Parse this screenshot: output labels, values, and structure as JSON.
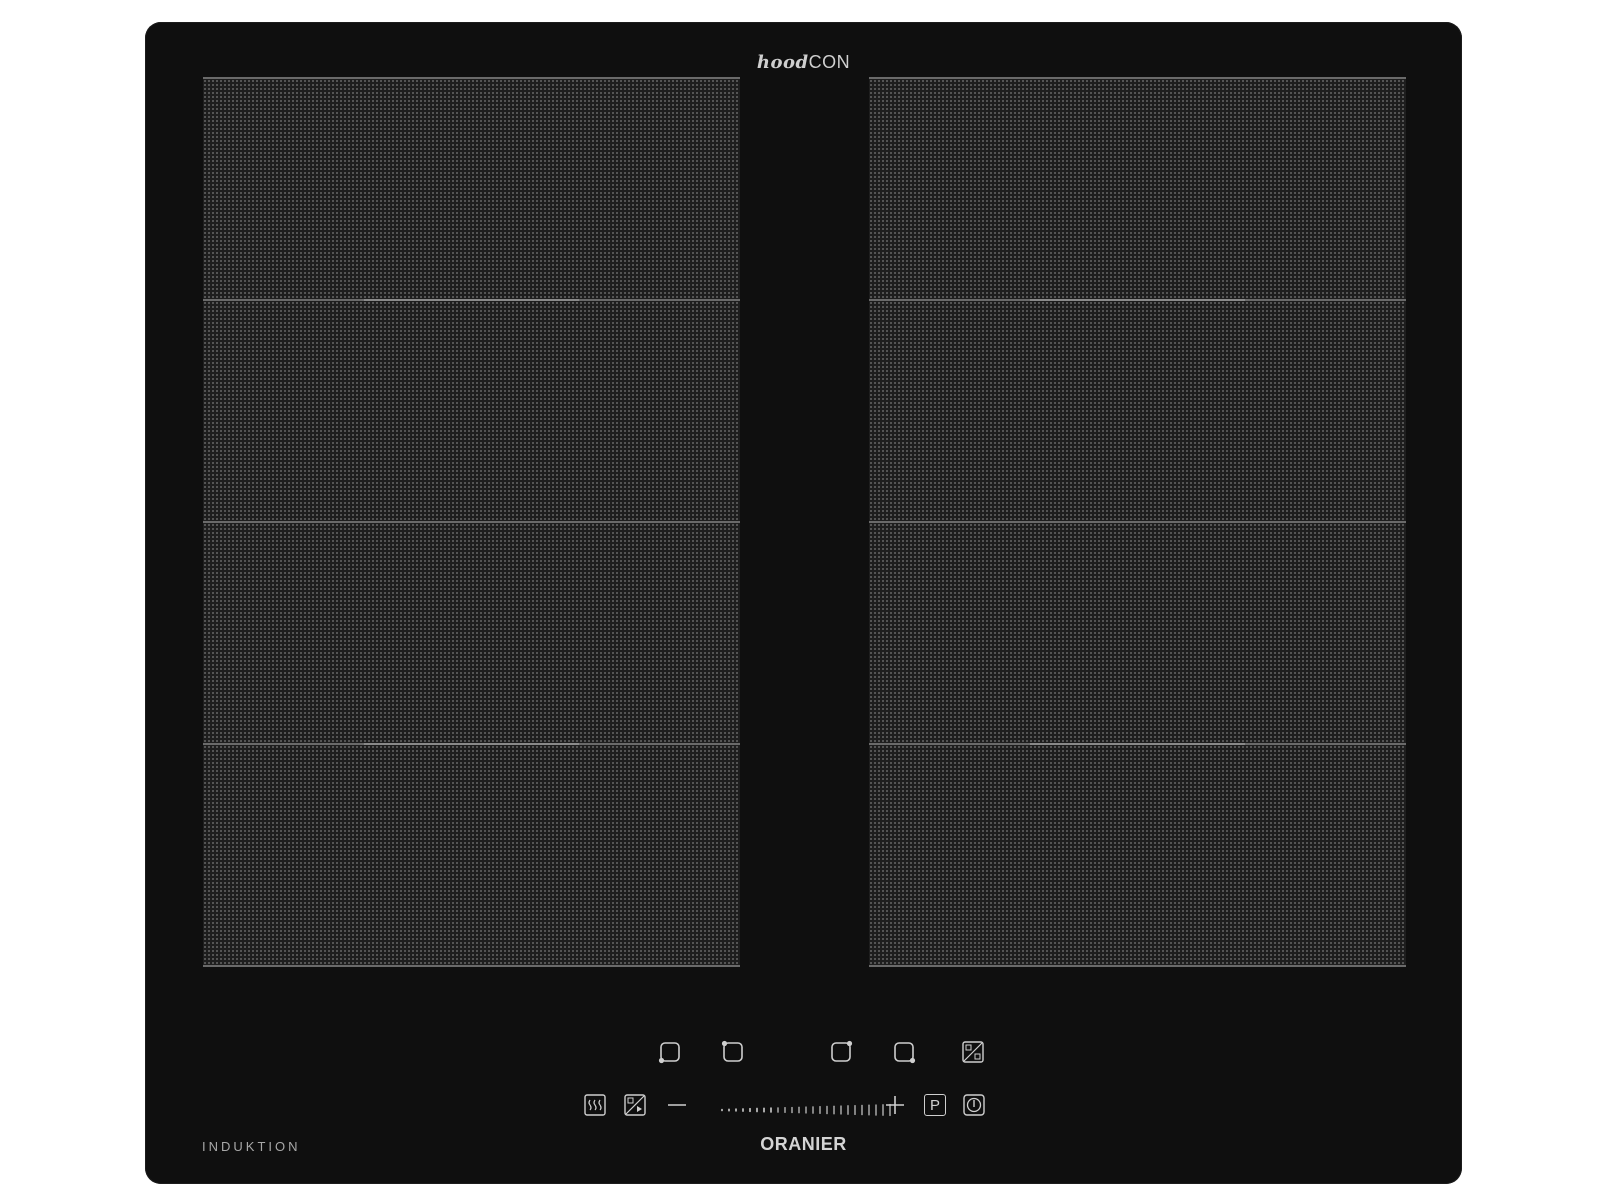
{
  "header": {
    "brand_italic": "hood",
    "brand_plain": "CON"
  },
  "labels": {
    "type": "INDUKTION",
    "brand": "ORANIER"
  },
  "zones": {
    "left": [
      "zone-1",
      "zone-2",
      "zone-3",
      "zone-4"
    ],
    "right": [
      "zone-5",
      "zone-6",
      "zone-7",
      "zone-8"
    ]
  },
  "controls": {
    "zone_selectors": [
      "front-left-zone-icon",
      "rear-left-zone-icon",
      "rear-right-zone-icon",
      "front-right-zone-icon"
    ],
    "flex_icon": "flex-zone-icon",
    "keep_warm_icon": "keep-warm-icon",
    "hood_icon": "hood-link-icon",
    "minus_icon": "minus-icon",
    "plus_icon": "plus-icon",
    "power_boost_label": "P",
    "power_icon": "power-icon"
  },
  "colors": {
    "glass": "#0f0f0f",
    "symbols": "#cfcfcf",
    "zone_pattern": "#5f5f5f"
  }
}
